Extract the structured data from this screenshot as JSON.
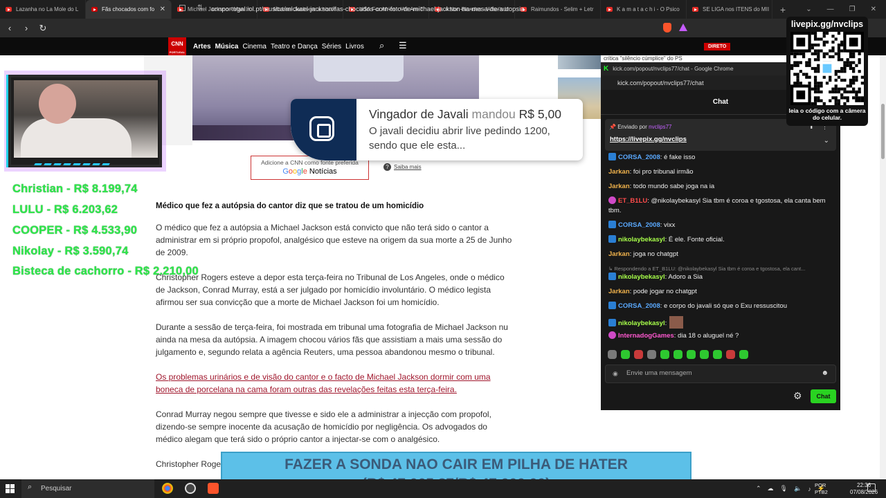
{
  "browser": {
    "tabs": [
      {
        "title": "Lazanha no La Mole do L",
        "kind": "yt"
      },
      {
        "title": "Fãs chocados com fo",
        "kind": "cnn",
        "active": true
      },
      {
        "title": "Michael Jackson - Man In",
        "kind": "yt"
      },
      {
        "title": "Michael Jackson: a histór",
        "kind": "yt"
      },
      {
        "title": "USA For Africa - We Are T",
        "kind": "yt"
      },
      {
        "title": "4 Non Blondes - What's U",
        "kind": "yt"
      },
      {
        "title": "Raimundos - Selim + Letr",
        "kind": "yt"
      },
      {
        "title": "K a m a t a c h i - O Psico",
        "kind": "yt"
      },
      {
        "title": "SE LIGA nos ITENS do MII",
        "kind": "yt"
      }
    ],
    "new_tab": "+",
    "url": "cnnportugal.iol.pt/musica/mickael-jackson/fas-chocados-com-foto-de-michael-jackson-na-mesa-de-autopsia"
  },
  "site": {
    "logo": "CNN",
    "logo_sub": "PORTUGAL",
    "nav": [
      "Artes",
      "Música",
      "Cinema",
      "Teatro e Dança",
      "Séries",
      "Livros"
    ],
    "live_label": "DIRETO",
    "sidebar_snippet": "crítica \"silêncio cúmplice\" do PS"
  },
  "article": {
    "gnews_caption": "Adicione a CNN como fonte preferida",
    "gnews_brand": [
      "G",
      "o",
      "o",
      "g",
      "l",
      "e"
    ],
    "gnews_suffix": " Notícias",
    "learn_more": "Saiba mais",
    "heading": "Médico que fez a autópsia do cantor diz que se tratou de um homicídio",
    "paragraphs": [
      "O médico que fez a autópsia a Michael Jackson está convicto que não terá sido o cantor a administrar em si próprio propofol, analgésico que esteve na origem da sua morte a 25 de Junho de 2009.",
      "Christopher Rogers esteve a depor esta terça-feira no Tribunal de Los Angeles, onde o médico de Jackson, Conrad Murray, está a ser julgado por homicídio involuntário. O médico legista afirmou ser sua convicção que a morte de Michael Jackson foi um homicídio.",
      "Durante a sessão de terça-feira, foi mostrada em tribunal uma fotografia de Michael Jackson nu ainda na mesa da autópsia. A imagem chocou vários fãs que assistiam a mais uma sessão do julgamento e, segundo relata a agência Reuters, uma pessoa abandonou mesmo o tribunal.",
      "Os problemas urinários e de visão do cantor e o facto de Michael Jackson dormir com uma boneca de porcelana na cama foram outras das revelações feitas esta terça-feira.",
      "Conrad Murray negou sempre que tivesse e sido ele a administrar a injecção com propofol, dizendo-se sempre inocente da acusação de homicídio por negligência. Os advogados do médico alegam que terá sido o próprio cantor a injectar-se com o analgésico.",
      "Christopher Roge... de dois minutos e..."
    ]
  },
  "overlay": {
    "donors": [
      "Christian - R$ 8.199,74",
      "LULU - R$ 6.203,62",
      "COOPER - R$ 4.533,90",
      "Nikolay - R$ 3.590,74",
      "Bisteca de cachorro - R$ 2.210,00"
    ],
    "alert": {
      "name": "Vingador de Javali",
      "verb": " mandou ",
      "amount": "R$ 5,00",
      "message": "O javali decidiu abrir live pedindo 1200, sendo que ele esta..."
    },
    "qr": {
      "title": "livepix.gg/nvclips",
      "caption": "leia o código com a câmera do celular."
    },
    "goal": {
      "line1": "FAZER A SONDA NAO CAIR EM PILHA DE HATER",
      "line2": "(R$ 47.065,87/R$ 47.000,00)",
      "progress_fraction": 1.0
    }
  },
  "chat": {
    "window_title": "kick.com/popout/nvclips77/chat - Google Chrome",
    "url": "kick.com/popout/nvclips77/chat",
    "header": "Chat",
    "pinned": {
      "label": "Enviado por",
      "user": "nvclips77",
      "link": "https://livepix.gg/nvclips"
    },
    "messages": [
      {
        "user": "CORSA_2008",
        "text": ": é fake isso",
        "badge": "blue",
        "ucls": "u1"
      },
      {
        "user": "Jarkan",
        "text": ": foi pro tribunal irmão",
        "badge": "",
        "ucls": "u2"
      },
      {
        "user": "Jarkan",
        "text": ": todo mundo sabe joga na ia",
        "badge": "",
        "ucls": "u2"
      },
      {
        "user": "ET_B1LU",
        "text": ": @nikolaybekasyl Sia tbm é coroa e tgostosa, ela canta bem tbm.",
        "badge": "pink",
        "ucls": "u3"
      },
      {
        "user": "CORSA_2008",
        "text": ": vixx",
        "badge": "blue",
        "ucls": "u1"
      },
      {
        "user": "nikolaybekasyl",
        "text": ": É ele. Fonte oficial.",
        "badge": "blue",
        "ucls": "u4"
      },
      {
        "user": "Jarkan",
        "text": ": joga no chatgpt",
        "badge": "",
        "ucls": "u2"
      },
      {
        "user": "nikolaybekasyl",
        "text": ": Adoro a Sia",
        "badge": "blue",
        "ucls": "u4"
      },
      {
        "user": "Jarkan",
        "text": ": pode jogar no chatgpt",
        "badge": "",
        "ucls": "u2"
      },
      {
        "user": "CORSA_2008",
        "text": ": e corpo do javali só que o Exu ressuscitou",
        "badge": "blue",
        "ucls": "u1"
      },
      {
        "user": "nikolaybekasyl",
        "text": ":",
        "badge": "blue",
        "ucls": "u4"
      },
      {
        "user": "InternadogGames",
        "text": ": dia 18 o aluguel né ?",
        "badge": "pink",
        "ucls": "u5"
      }
    ],
    "reply_hint": "↳ Respondendo a ET_B1LU: @nikolaybekasyl Sia tbm é coroa e tgostosa, ela cant...",
    "input_placeholder": "Envie uma mensagem",
    "send_label": "Chat"
  },
  "taskbar": {
    "search_placeholder": "Pesquisar",
    "lang": "POR",
    "lang2": "PTB2",
    "time": "22:36",
    "date": "07/08/2026"
  }
}
